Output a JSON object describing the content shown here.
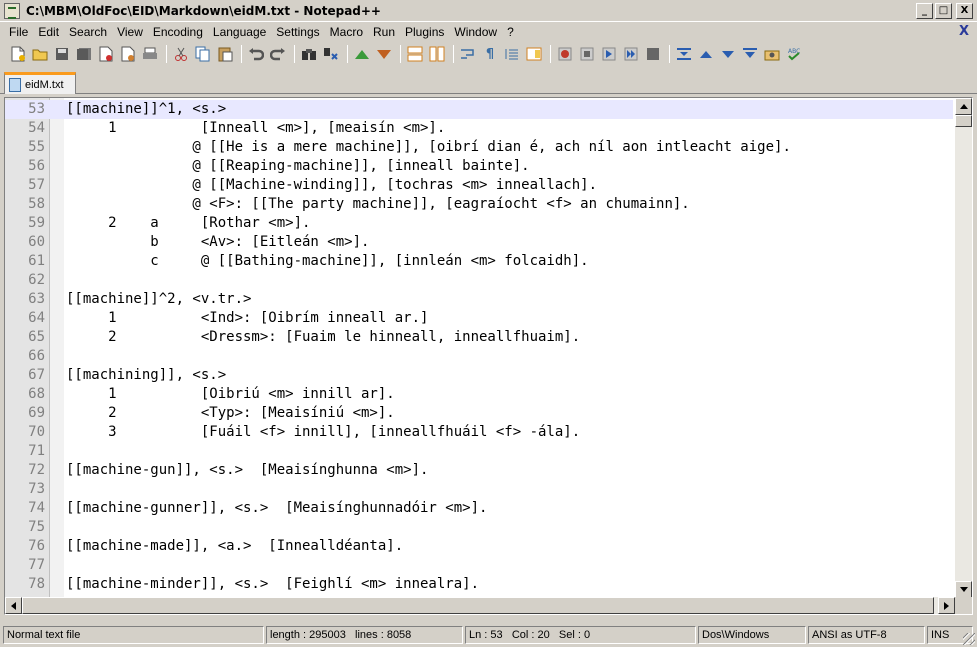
{
  "window": {
    "title": "C:\\MBM\\OldFoc\\EID\\Markdown\\eidM.txt - Notepad++",
    "minimize": "_",
    "maximize": "□",
    "close": "X"
  },
  "menu": {
    "items": [
      "File",
      "Edit",
      "Search",
      "View",
      "Encoding",
      "Language",
      "Settings",
      "Macro",
      "Run",
      "Plugins",
      "Window",
      "?"
    ],
    "close_label": "X"
  },
  "toolbar": {
    "icons": [
      "new-file-icon",
      "open-file-icon",
      "save-icon",
      "save-all-icon",
      "close-icon",
      "close-all-icon",
      "print-icon",
      "cut-icon",
      "copy-icon",
      "paste-icon",
      "undo-icon",
      "redo-icon",
      "find-icon",
      "replace-icon",
      "zoom-in-icon",
      "zoom-out-icon",
      "sync-v-icon",
      "sync-h-icon",
      "word-wrap-icon",
      "show-all-chars-icon",
      "indent-guide-icon",
      "doc-map-icon",
      "record-macro-icon",
      "stop-record-icon",
      "play-macro-icon",
      "run-macro-multiple-icon",
      "save-macro-icon",
      "trim-icon",
      "up-icon",
      "down-icon",
      "sort-icon",
      "spell-icon",
      "spellcheck-icon"
    ],
    "colors": {
      "record": "#c0392b",
      "play_blue": "#2a5db0",
      "stop": "#555555"
    }
  },
  "tabs": [
    {
      "label": "eidM.txt",
      "active": true
    }
  ],
  "editor": {
    "current_line": 53,
    "lines": [
      {
        "n": "53",
        "text": "[[machine]]^1, <s.>"
      },
      {
        "n": "54",
        "text": "     1          [Inneall <m>], [meaisín <m>]."
      },
      {
        "n": "55",
        "text": "               @ [[He is a mere machine]], [oibrí dian é, ach níl aon intleacht aige]."
      },
      {
        "n": "56",
        "text": "               @ [[Reaping-machine]], [inneall bainte]."
      },
      {
        "n": "57",
        "text": "               @ [[Machine-winding]], [tochras <m> inneallach]."
      },
      {
        "n": "58",
        "text": "               @ <F>: [[The party machine]], [eagraíocht <f> an chumainn]."
      },
      {
        "n": "59",
        "text": "     2    a     [Rothar <m>]."
      },
      {
        "n": "60",
        "text": "          b     <Av>: [Eitleán <m>]."
      },
      {
        "n": "61",
        "text": "          c     @ [[Bathing-machine]], [innleán <m> folcaidh]."
      },
      {
        "n": "62",
        "text": ""
      },
      {
        "n": "63",
        "text": "[[machine]]^2, <v.tr.>"
      },
      {
        "n": "64",
        "text": "     1          <Ind>: [Oibrím inneall ar.]"
      },
      {
        "n": "65",
        "text": "     2          <Dressm>: [Fuaim le hinneall, inneallfhuaim]."
      },
      {
        "n": "66",
        "text": ""
      },
      {
        "n": "67",
        "text": "[[machining]], <s.>"
      },
      {
        "n": "68",
        "text": "     1          [Oibriú <m> innill ar]."
      },
      {
        "n": "69",
        "text": "     2          <Typ>: [Meaisíniú <m>]."
      },
      {
        "n": "70",
        "text": "     3          [Fuáil <f> innill], [inneallfhuáil <f> -ála]."
      },
      {
        "n": "71",
        "text": ""
      },
      {
        "n": "72",
        "text": "[[machine-gun]], <s.>  [Meaisínghunna <m>]."
      },
      {
        "n": "73",
        "text": ""
      },
      {
        "n": "74",
        "text": "[[machine-gunner]], <s.>  [Meaisínghunnadóir <m>]."
      },
      {
        "n": "75",
        "text": ""
      },
      {
        "n": "76",
        "text": "[[machine-made]], <a.>  [Innealldéanta]."
      },
      {
        "n": "77",
        "text": ""
      },
      {
        "n": "78",
        "text": "[[machine-minder]], <s.>  [Feighlí <m> innealra]."
      }
    ]
  },
  "status": {
    "file_type": "Normal text file",
    "length": "length : 295003",
    "lines": "lines : 8058",
    "ln": "Ln : 53",
    "col": "Col : 20",
    "sel": "Sel : 0",
    "eol": "Dos\\Windows",
    "encoding": "ANSI as UTF-8",
    "mode": "INS"
  }
}
